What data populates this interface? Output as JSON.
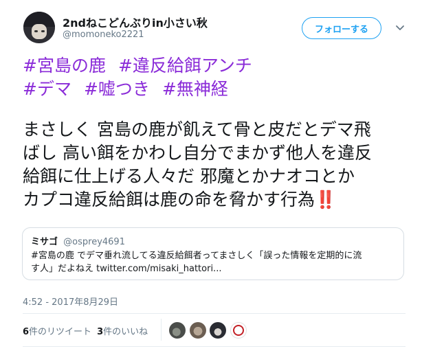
{
  "author": {
    "display_name": "2ndねこどんぶりin小さい秋",
    "handle": "@momoneko2221",
    "follow_label": "フォローする"
  },
  "tweet": {
    "hashtags": [
      "#宮島の鹿",
      "#違反給餌アンチ",
      "#デマ",
      "#嘘つき",
      "#無神経"
    ],
    "body_lines": [
      "まさしく 宮島の鹿が飢えて骨と皮だとデマ飛",
      "ばし 高い餌をかわし自分でまかず他人を違反",
      "給餌に仕上げる人々だ  邪魔とかナオコとか",
      "カプコ違反給餌は鹿の命を脅かす行為"
    ],
    "emoji": "‼️",
    "timestamp": "4:52 - 2017年8月29日"
  },
  "quote": {
    "name": "ミサゴ",
    "handle": "@osprey4691",
    "text_lines": [
      "#宮島の鹿  でデマ垂れ流してる違反給餌者ってまさしく「誤った情報を定期的に流",
      "す人」だよねえ twitter.com/misaki_hattori..."
    ]
  },
  "stats": {
    "retweet_count": "6",
    "retweet_label": "件のリツイート",
    "like_count": "3",
    "like_label": "件のいいね"
  },
  "icons": {
    "caret": "chevron-down-icon",
    "hashtag_color": "#8a2bd8",
    "accent": "#1da1f2"
  }
}
